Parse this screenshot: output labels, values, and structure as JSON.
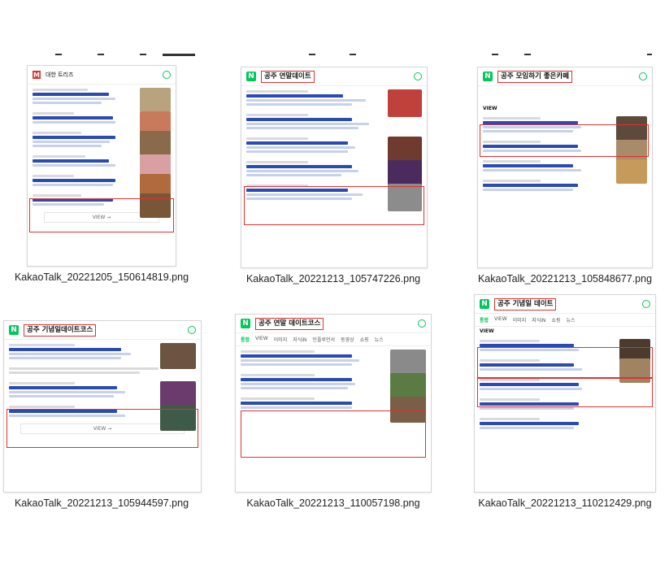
{
  "files": [
    {
      "name": "KakaoTalk_20221205_150614819.png",
      "query": "대한 트리즈",
      "header_style": "m"
    },
    {
      "name": "KakaoTalk_20221213_105747226.png",
      "query": "공주 연말데이트",
      "header_style": "n"
    },
    {
      "name": "KakaoTalk_20221213_105848677.png",
      "query": "공주 모임하기 좋은카페",
      "header_style": "n"
    },
    {
      "name": "KakaoTalk_20221213_105944597.png",
      "query": "공주 기념일데이트코스",
      "header_style": "n"
    },
    {
      "name": "KakaoTalk_20221213_110057198.png",
      "query": "공주 연말 데이트코스",
      "header_style": "n"
    },
    {
      "name": "KakaoTalk_20221213_110212429.png",
      "query": "공주 기념일 데이트",
      "header_style": "n"
    }
  ],
  "colors": {
    "naver_green": "#03c75a",
    "highlight_red": "#e03131",
    "title_blue": "#2a4bb5"
  },
  "icons": {
    "naver": "N",
    "search": "search-icon"
  }
}
